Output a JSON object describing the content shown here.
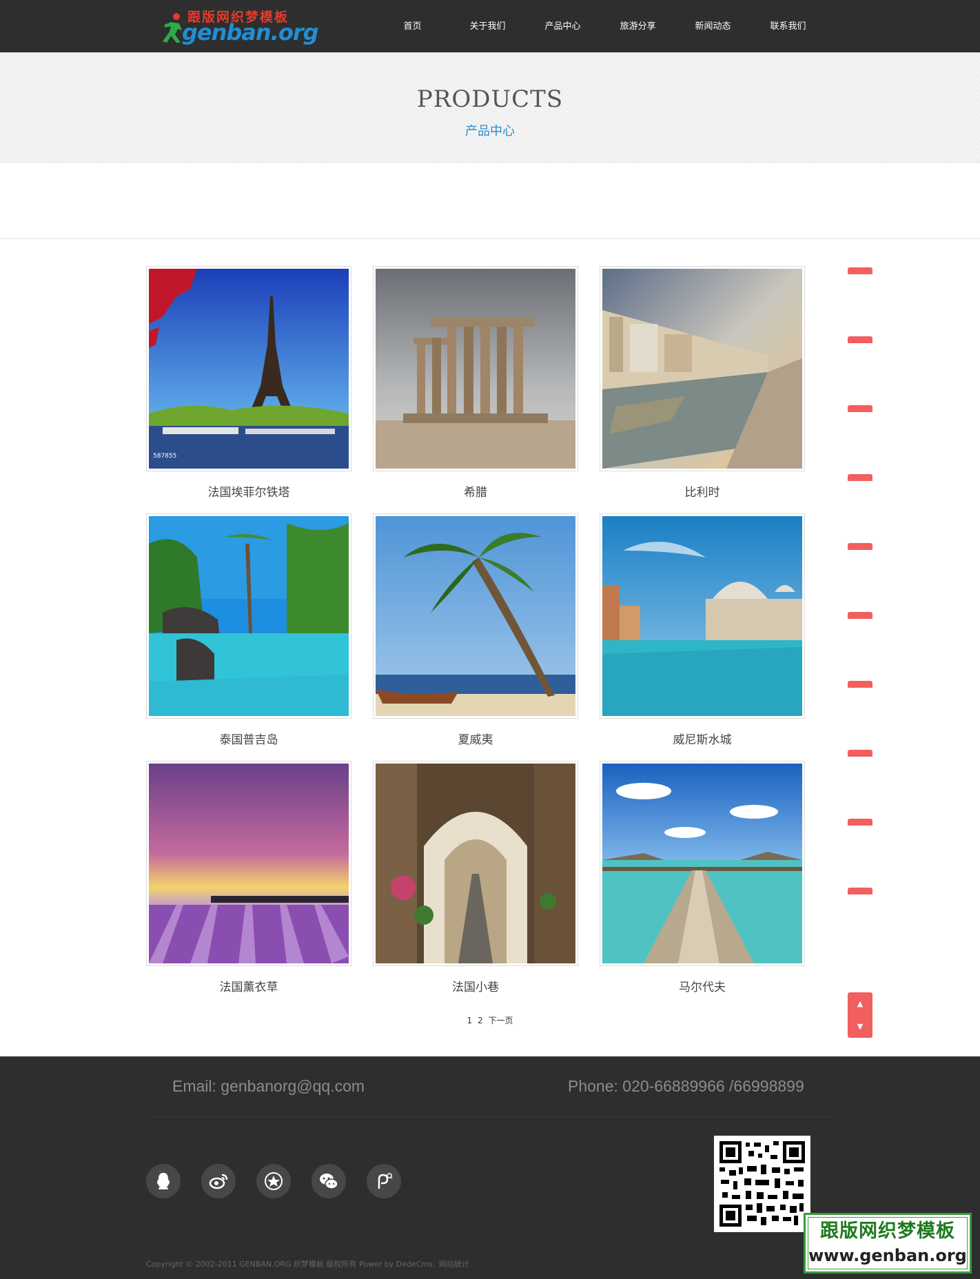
{
  "header": {
    "logo_top_text": "跟版网织梦模板",
    "logo_main_text": "genban.org",
    "nav": [
      "首页",
      "关于我们",
      "产品中心",
      "旅游分享",
      "新闻动态",
      "联系我们"
    ]
  },
  "banner": {
    "title": "PRODUCTS",
    "subtitle": "产品中心"
  },
  "products": [
    {
      "title": "法国埃菲尔铁塔",
      "image": "eiffel-tower-photo",
      "watermark": "587855"
    },
    {
      "title": "希腊",
      "image": "greek-temple-photo"
    },
    {
      "title": "比利时",
      "image": "belgium-canal-photo"
    },
    {
      "title": "泰国普吉岛",
      "image": "phuket-pool-photo"
    },
    {
      "title": "夏威夷",
      "image": "hawaii-palm-photo"
    },
    {
      "title": "威尼斯水城",
      "image": "venice-photo"
    },
    {
      "title": "法国薰衣草",
      "image": "lavender-field-photo"
    },
    {
      "title": "法国小巷",
      "image": "french-alley-photo"
    },
    {
      "title": "马尔代夫",
      "image": "maldives-pier-photo"
    }
  ],
  "pagination": {
    "pages": [
      "1",
      "2"
    ],
    "next_label": "下一页"
  },
  "sidebar": {
    "tab_count": 10,
    "scroll_up": "▲",
    "scroll_down": "▼",
    "accent_color": "#f25f5f"
  },
  "footer": {
    "email": "Email: genbanorg@qq.com",
    "phone": "Phone: 020-66889966 /66998899",
    "social_icons": [
      "qq-icon",
      "weibo-icon",
      "favorite-icon",
      "wechat-icon",
      "search-feed-icon"
    ],
    "copyright_parts": [
      "Copyright © 2002-2011 GENBAN.ORG 织梦模板 版权所有 Power by DedeCms.",
      "网站统计"
    ]
  },
  "watermark": {
    "cn": "跟版网织梦模板",
    "url": "www.genban.org"
  }
}
